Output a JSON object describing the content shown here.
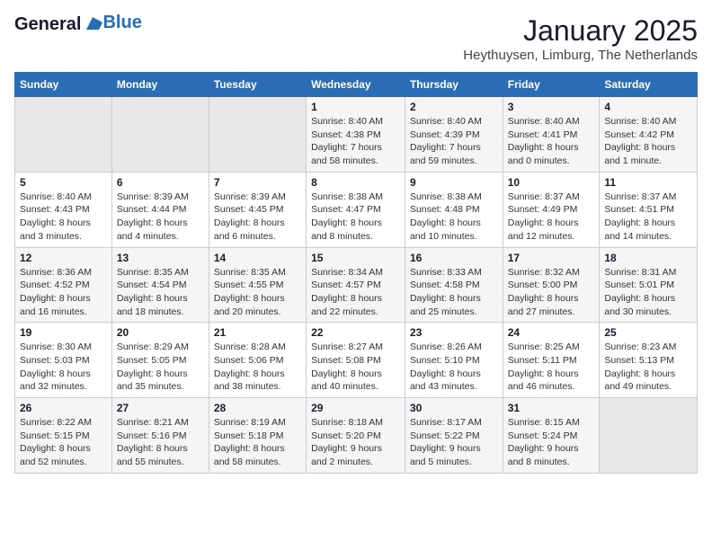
{
  "header": {
    "logo_general": "General",
    "logo_blue": "Blue",
    "month_year": "January 2025",
    "location": "Heythuysen, Limburg, The Netherlands"
  },
  "weekdays": [
    "Sunday",
    "Monday",
    "Tuesday",
    "Wednesday",
    "Thursday",
    "Friday",
    "Saturday"
  ],
  "weeks": [
    [
      {
        "day": "",
        "content": ""
      },
      {
        "day": "",
        "content": ""
      },
      {
        "day": "",
        "content": ""
      },
      {
        "day": "1",
        "content": "Sunrise: 8:40 AM\nSunset: 4:38 PM\nDaylight: 7 hours and 58 minutes."
      },
      {
        "day": "2",
        "content": "Sunrise: 8:40 AM\nSunset: 4:39 PM\nDaylight: 7 hours and 59 minutes."
      },
      {
        "day": "3",
        "content": "Sunrise: 8:40 AM\nSunset: 4:41 PM\nDaylight: 8 hours and 0 minutes."
      },
      {
        "day": "4",
        "content": "Sunrise: 8:40 AM\nSunset: 4:42 PM\nDaylight: 8 hours and 1 minute."
      }
    ],
    [
      {
        "day": "5",
        "content": "Sunrise: 8:40 AM\nSunset: 4:43 PM\nDaylight: 8 hours and 3 minutes."
      },
      {
        "day": "6",
        "content": "Sunrise: 8:39 AM\nSunset: 4:44 PM\nDaylight: 8 hours and 4 minutes."
      },
      {
        "day": "7",
        "content": "Sunrise: 8:39 AM\nSunset: 4:45 PM\nDaylight: 8 hours and 6 minutes."
      },
      {
        "day": "8",
        "content": "Sunrise: 8:38 AM\nSunset: 4:47 PM\nDaylight: 8 hours and 8 minutes."
      },
      {
        "day": "9",
        "content": "Sunrise: 8:38 AM\nSunset: 4:48 PM\nDaylight: 8 hours and 10 minutes."
      },
      {
        "day": "10",
        "content": "Sunrise: 8:37 AM\nSunset: 4:49 PM\nDaylight: 8 hours and 12 minutes."
      },
      {
        "day": "11",
        "content": "Sunrise: 8:37 AM\nSunset: 4:51 PM\nDaylight: 8 hours and 14 minutes."
      }
    ],
    [
      {
        "day": "12",
        "content": "Sunrise: 8:36 AM\nSunset: 4:52 PM\nDaylight: 8 hours and 16 minutes."
      },
      {
        "day": "13",
        "content": "Sunrise: 8:35 AM\nSunset: 4:54 PM\nDaylight: 8 hours and 18 minutes."
      },
      {
        "day": "14",
        "content": "Sunrise: 8:35 AM\nSunset: 4:55 PM\nDaylight: 8 hours and 20 minutes."
      },
      {
        "day": "15",
        "content": "Sunrise: 8:34 AM\nSunset: 4:57 PM\nDaylight: 8 hours and 22 minutes."
      },
      {
        "day": "16",
        "content": "Sunrise: 8:33 AM\nSunset: 4:58 PM\nDaylight: 8 hours and 25 minutes."
      },
      {
        "day": "17",
        "content": "Sunrise: 8:32 AM\nSunset: 5:00 PM\nDaylight: 8 hours and 27 minutes."
      },
      {
        "day": "18",
        "content": "Sunrise: 8:31 AM\nSunset: 5:01 PM\nDaylight: 8 hours and 30 minutes."
      }
    ],
    [
      {
        "day": "19",
        "content": "Sunrise: 8:30 AM\nSunset: 5:03 PM\nDaylight: 8 hours and 32 minutes."
      },
      {
        "day": "20",
        "content": "Sunrise: 8:29 AM\nSunset: 5:05 PM\nDaylight: 8 hours and 35 minutes."
      },
      {
        "day": "21",
        "content": "Sunrise: 8:28 AM\nSunset: 5:06 PM\nDaylight: 8 hours and 38 minutes."
      },
      {
        "day": "22",
        "content": "Sunrise: 8:27 AM\nSunset: 5:08 PM\nDaylight: 8 hours and 40 minutes."
      },
      {
        "day": "23",
        "content": "Sunrise: 8:26 AM\nSunset: 5:10 PM\nDaylight: 8 hours and 43 minutes."
      },
      {
        "day": "24",
        "content": "Sunrise: 8:25 AM\nSunset: 5:11 PM\nDaylight: 8 hours and 46 minutes."
      },
      {
        "day": "25",
        "content": "Sunrise: 8:23 AM\nSunset: 5:13 PM\nDaylight: 8 hours and 49 minutes."
      }
    ],
    [
      {
        "day": "26",
        "content": "Sunrise: 8:22 AM\nSunset: 5:15 PM\nDaylight: 8 hours and 52 minutes."
      },
      {
        "day": "27",
        "content": "Sunrise: 8:21 AM\nSunset: 5:16 PM\nDaylight: 8 hours and 55 minutes."
      },
      {
        "day": "28",
        "content": "Sunrise: 8:19 AM\nSunset: 5:18 PM\nDaylight: 8 hours and 58 minutes."
      },
      {
        "day": "29",
        "content": "Sunrise: 8:18 AM\nSunset: 5:20 PM\nDaylight: 9 hours and 2 minutes."
      },
      {
        "day": "30",
        "content": "Sunrise: 8:17 AM\nSunset: 5:22 PM\nDaylight: 9 hours and 5 minutes."
      },
      {
        "day": "31",
        "content": "Sunrise: 8:15 AM\nSunset: 5:24 PM\nDaylight: 9 hours and 8 minutes."
      },
      {
        "day": "",
        "content": ""
      }
    ]
  ]
}
